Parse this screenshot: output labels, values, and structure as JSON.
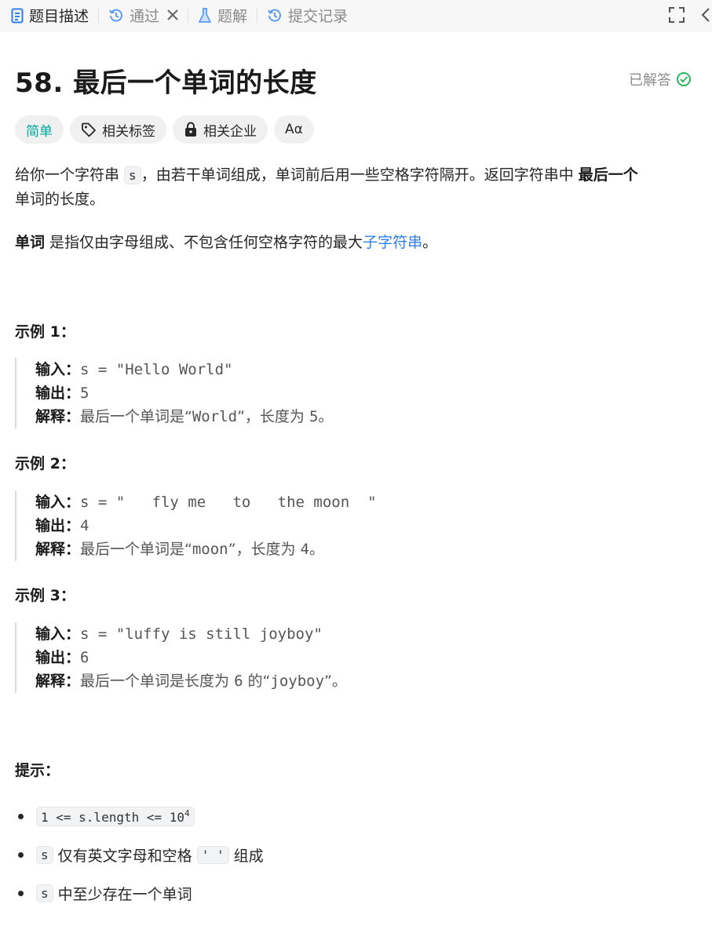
{
  "tabs": {
    "description": "题目描述",
    "passed": "通过",
    "solutions": "题解",
    "submissions": "提交记录"
  },
  "problem": {
    "title": "58. 最后一个单词的长度",
    "status": "已解答",
    "difficulty": "简单",
    "tags_label": "相关标签",
    "companies_label": "相关企业",
    "translate_label": "Aα"
  },
  "description": {
    "p1_a": "给你一个字符串 ",
    "p1_code": "s",
    "p1_b": "，由若干单词组成，单词前后用一些空格字符隔开。返回字符串中 ",
    "p1_bold": "最后一个",
    "p1_c": "单词的长度。",
    "p2_bold": "单词",
    "p2_a": " 是指仅由字母组成、不包含任何空格字符的最大",
    "p2_link": "子字符串",
    "p2_b": "。"
  },
  "examples": [
    {
      "heading": "示例 1：",
      "input_label": "输入：",
      "input": "s = \"Hello World\"",
      "output_label": "输出：",
      "output": "5",
      "explain_label": "解释：",
      "explain_a": "最后一个单词是“",
      "explain_code": "World",
      "explain_b": "”，长度为 ",
      "explain_num": "5",
      "explain_c": "。"
    },
    {
      "heading": "示例 2：",
      "input_label": "输入：",
      "input": "s = \"   fly me   to   the moon  \"",
      "output_label": "输出：",
      "output": "4",
      "explain_label": "解释：",
      "explain_a": "最后一个单词是“",
      "explain_code": "moon",
      "explain_b": "”，长度为 ",
      "explain_num": "4",
      "explain_c": "。"
    },
    {
      "heading": "示例 3：",
      "input_label": "输入：",
      "input": "s = \"luffy is still joyboy\"",
      "output_label": "输出：",
      "output": "6",
      "explain_label": "解释：",
      "explain_a": "最后一个单词是长度为 ",
      "explain_code": "6",
      "explain_b": " 的“",
      "explain_num": "joyboy",
      "explain_c": "”。"
    }
  ],
  "hints": {
    "heading": "提示：",
    "c1_code": "1 <= s.length <= 10",
    "c1_sup": "4",
    "c2_code": "s",
    "c2_a": " 仅有英文字母和空格 ",
    "c2_code2": "' '",
    "c2_b": " 组成",
    "c3_code": "s",
    "c3_a": " 中至少存在一个单词"
  },
  "colors": {
    "accent_blue": "#2d7ef0",
    "easy_teal": "#00a99d",
    "solved_green": "#2db55d",
    "tab_icon_blue": "#5b9cf4"
  },
  "icons": [
    "document-icon",
    "history-icon",
    "close-icon",
    "flask-icon",
    "history-icon",
    "fullscreen-icon",
    "chevron-left-icon",
    "check-circle-icon",
    "tag-icon",
    "lock-icon",
    "translate-icon"
  ]
}
